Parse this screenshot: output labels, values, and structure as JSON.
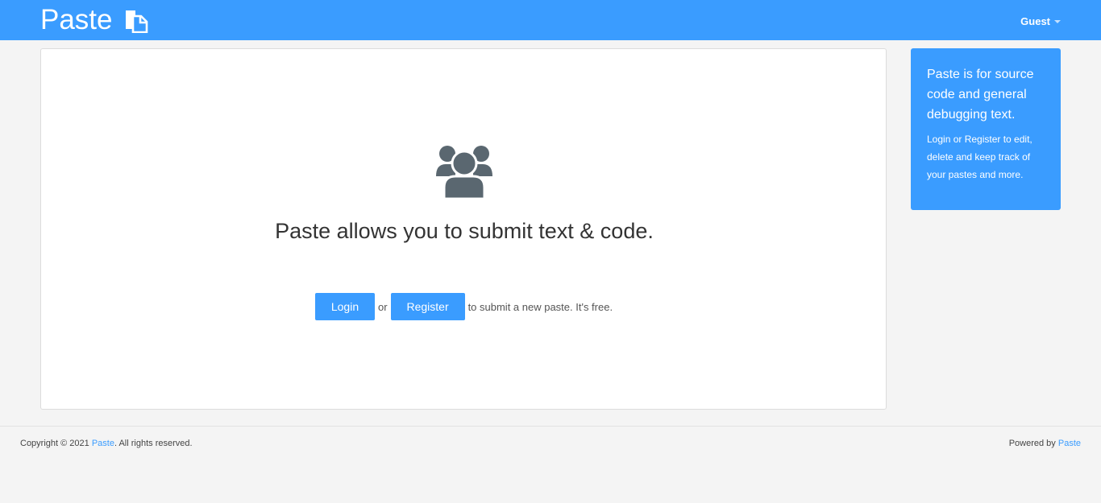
{
  "navbar": {
    "brand": "Paste",
    "brand_icon": "copy-document-icon",
    "user_menu_label": "Guest",
    "background": "#3a9cff"
  },
  "main": {
    "hero_icon": "users-group-icon",
    "headline": "Paste allows you to submit text & code.",
    "login_label": "Login",
    "or_text": "or",
    "register_label": "Register",
    "tail_text": "to submit a new paste. It's free."
  },
  "sidebar": {
    "title": "Paste is for source code and general debugging text.",
    "subtitle": "Login or Register to edit, delete and keep track of your pastes and more.",
    "background": "#3a9cff"
  },
  "footer": {
    "copyright_prefix": "Copyright © 2021",
    "copyright_link": "Paste",
    "copyright_suffix": ". All rights reserved.",
    "powered_prefix": "Powered by",
    "powered_link": "Paste"
  },
  "colors": {
    "accent": "#3a9cff",
    "icon_gray": "#5a6770",
    "page_bg": "#f4f4f4"
  }
}
